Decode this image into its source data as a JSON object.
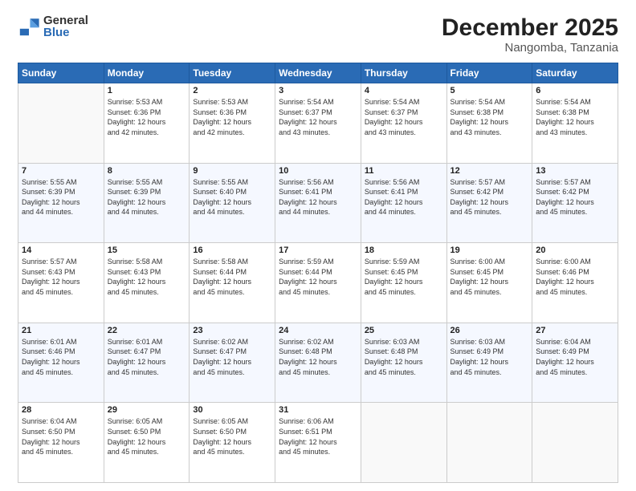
{
  "logo": {
    "general": "General",
    "blue": "Blue"
  },
  "header": {
    "month": "December 2025",
    "location": "Nangomba, Tanzania"
  },
  "weekdays": [
    "Sunday",
    "Monday",
    "Tuesday",
    "Wednesday",
    "Thursday",
    "Friday",
    "Saturday"
  ],
  "weeks": [
    [
      {
        "day": null
      },
      {
        "day": 1,
        "sunrise": "5:53 AM",
        "sunset": "6:36 PM",
        "daylight": "12 hours and 42 minutes."
      },
      {
        "day": 2,
        "sunrise": "5:53 AM",
        "sunset": "6:36 PM",
        "daylight": "12 hours and 42 minutes."
      },
      {
        "day": 3,
        "sunrise": "5:54 AM",
        "sunset": "6:37 PM",
        "daylight": "12 hours and 43 minutes."
      },
      {
        "day": 4,
        "sunrise": "5:54 AM",
        "sunset": "6:37 PM",
        "daylight": "12 hours and 43 minutes."
      },
      {
        "day": 5,
        "sunrise": "5:54 AM",
        "sunset": "6:38 PM",
        "daylight": "12 hours and 43 minutes."
      },
      {
        "day": 6,
        "sunrise": "5:54 AM",
        "sunset": "6:38 PM",
        "daylight": "12 hours and 43 minutes."
      }
    ],
    [
      {
        "day": 7,
        "sunrise": "5:55 AM",
        "sunset": "6:39 PM",
        "daylight": "12 hours and 44 minutes."
      },
      {
        "day": 8,
        "sunrise": "5:55 AM",
        "sunset": "6:39 PM",
        "daylight": "12 hours and 44 minutes."
      },
      {
        "day": 9,
        "sunrise": "5:55 AM",
        "sunset": "6:40 PM",
        "daylight": "12 hours and 44 minutes."
      },
      {
        "day": 10,
        "sunrise": "5:56 AM",
        "sunset": "6:41 PM",
        "daylight": "12 hours and 44 minutes."
      },
      {
        "day": 11,
        "sunrise": "5:56 AM",
        "sunset": "6:41 PM",
        "daylight": "12 hours and 44 minutes."
      },
      {
        "day": 12,
        "sunrise": "5:57 AM",
        "sunset": "6:42 PM",
        "daylight": "12 hours and 45 minutes."
      },
      {
        "day": 13,
        "sunrise": "5:57 AM",
        "sunset": "6:42 PM",
        "daylight": "12 hours and 45 minutes."
      }
    ],
    [
      {
        "day": 14,
        "sunrise": "5:57 AM",
        "sunset": "6:43 PM",
        "daylight": "12 hours and 45 minutes."
      },
      {
        "day": 15,
        "sunrise": "5:58 AM",
        "sunset": "6:43 PM",
        "daylight": "12 hours and 45 minutes."
      },
      {
        "day": 16,
        "sunrise": "5:58 AM",
        "sunset": "6:44 PM",
        "daylight": "12 hours and 45 minutes."
      },
      {
        "day": 17,
        "sunrise": "5:59 AM",
        "sunset": "6:44 PM",
        "daylight": "12 hours and 45 minutes."
      },
      {
        "day": 18,
        "sunrise": "5:59 AM",
        "sunset": "6:45 PM",
        "daylight": "12 hours and 45 minutes."
      },
      {
        "day": 19,
        "sunrise": "6:00 AM",
        "sunset": "6:45 PM",
        "daylight": "12 hours and 45 minutes."
      },
      {
        "day": 20,
        "sunrise": "6:00 AM",
        "sunset": "6:46 PM",
        "daylight": "12 hours and 45 minutes."
      }
    ],
    [
      {
        "day": 21,
        "sunrise": "6:01 AM",
        "sunset": "6:46 PM",
        "daylight": "12 hours and 45 minutes."
      },
      {
        "day": 22,
        "sunrise": "6:01 AM",
        "sunset": "6:47 PM",
        "daylight": "12 hours and 45 minutes."
      },
      {
        "day": 23,
        "sunrise": "6:02 AM",
        "sunset": "6:47 PM",
        "daylight": "12 hours and 45 minutes."
      },
      {
        "day": 24,
        "sunrise": "6:02 AM",
        "sunset": "6:48 PM",
        "daylight": "12 hours and 45 minutes."
      },
      {
        "day": 25,
        "sunrise": "6:03 AM",
        "sunset": "6:48 PM",
        "daylight": "12 hours and 45 minutes."
      },
      {
        "day": 26,
        "sunrise": "6:03 AM",
        "sunset": "6:49 PM",
        "daylight": "12 hours and 45 minutes."
      },
      {
        "day": 27,
        "sunrise": "6:04 AM",
        "sunset": "6:49 PM",
        "daylight": "12 hours and 45 minutes."
      }
    ],
    [
      {
        "day": 28,
        "sunrise": "6:04 AM",
        "sunset": "6:50 PM",
        "daylight": "12 hours and 45 minutes."
      },
      {
        "day": 29,
        "sunrise": "6:05 AM",
        "sunset": "6:50 PM",
        "daylight": "12 hours and 45 minutes."
      },
      {
        "day": 30,
        "sunrise": "6:05 AM",
        "sunset": "6:50 PM",
        "daylight": "12 hours and 45 minutes."
      },
      {
        "day": 31,
        "sunrise": "6:06 AM",
        "sunset": "6:51 PM",
        "daylight": "12 hours and 45 minutes."
      },
      {
        "day": null
      },
      {
        "day": null
      },
      {
        "day": null
      }
    ]
  ]
}
